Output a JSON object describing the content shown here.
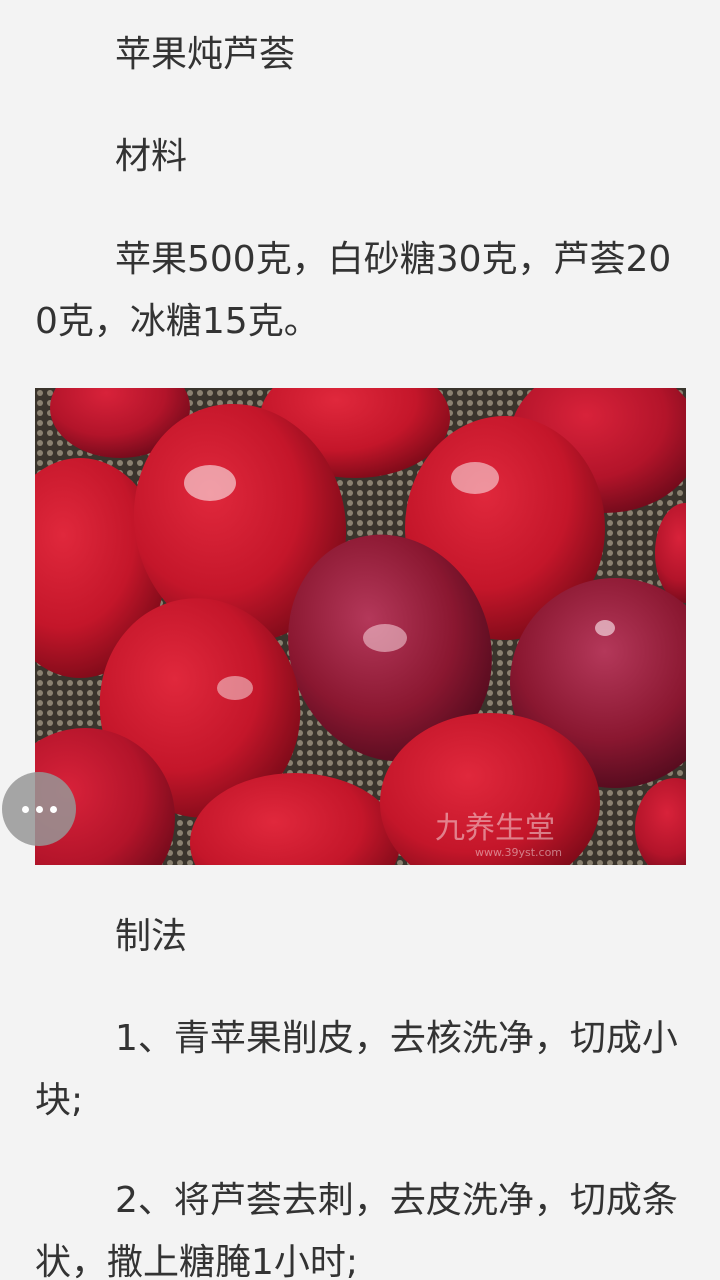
{
  "article": {
    "title": "苹果炖芦荟",
    "materials_heading": "材料",
    "materials": "苹果500克，白砂糖30克，芦荟200克，冰糖15克。",
    "method_heading": "制法",
    "steps": [
      "1、青苹果削皮，去核洗净，切成小块;",
      "2、将芦荟去刺，去皮洗净，切成条状，撒上糖腌1小时;"
    ]
  },
  "image": {
    "watermark": "九养生堂",
    "watermark_url": "www.39yst.com",
    "apple_red": "#c4162a",
    "apple_dark": "#8a1730"
  },
  "float_button": {
    "icon": "more-dots-icon"
  }
}
